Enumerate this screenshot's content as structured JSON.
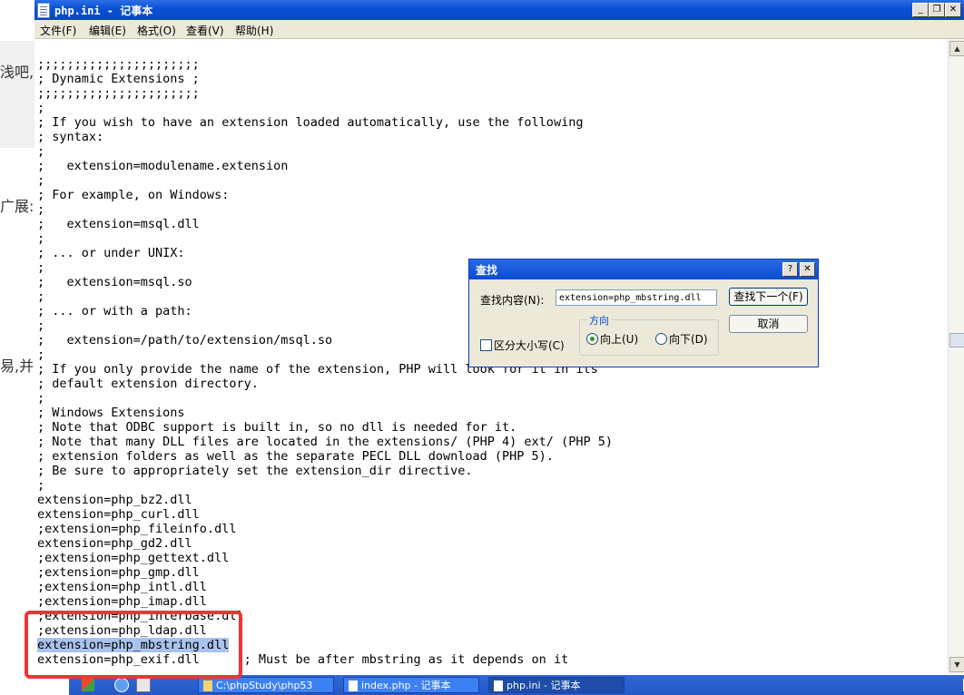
{
  "background_page": {
    "fragments": [
      "浅吧,山",
      "广展:",
      "易,并"
    ]
  },
  "window": {
    "title": "php.ini - 记事本",
    "controls": {
      "minimize": "_",
      "restore": "❐",
      "close": "✕"
    },
    "menu": [
      "文件(F)",
      "编辑(E)",
      "格式(O)",
      "查看(V)",
      "帮助(H)"
    ]
  },
  "editor": {
    "lines_before_selection": ";;;;;;;;;;;;;;;;;;;;;;\n; Dynamic Extensions ;\n;;;;;;;;;;;;;;;;;;;;;;\n;\n; If you wish to have an extension loaded automatically, use the following\n; syntax:\n;\n;   extension=modulename.extension\n;\n; For example, on Windows:\n;\n;   extension=msql.dll\n;\n; ... or under UNIX:\n;\n;   extension=msql.so\n;\n; ... or with a path:\n;\n;   extension=/path/to/extension/msql.so\n;\n; If you only provide the name of the extension, PHP will look for it in its\n; default extension directory.\n;\n; Windows Extensions\n; Note that ODBC support is built in, so no dll is needed for it.\n; Note that many DLL files are located in the extensions/ (PHP 4) ext/ (PHP 5)\n; extension folders as well as the separate PECL DLL download (PHP 5).\n; Be sure to appropriately set the extension_dir directive.\n;\nextension=php_bz2.dll\nextension=php_curl.dll\n;extension=php_fileinfo.dll\nextension=php_gd2.dll\n;extension=php_gettext.dll\n;extension=php_gmp.dll\n;extension=php_intl.dll\n;extension=php_imap.dll\n;extension=php_interbase.dll\n;extension=php_ldap.dll\n",
    "selected_line": "extension=php_mbstring.dll",
    "lines_after_selection": "\nextension=php_exif.dll      ; Must be after mbstring as it depends on it"
  },
  "find_dialog": {
    "title": "查找",
    "help": "?",
    "close": "✕",
    "find_label": "查找内容(N):",
    "find_value": "extension=php_mbstring.dll",
    "find_next": "查找下一个(F)",
    "cancel": "取消",
    "direction_label": "方向",
    "up": "向上(U)",
    "down": "向下(D)",
    "match_case": "区分大小写(C)"
  },
  "taskbar": {
    "tasks": [
      "C:\\phpStudy\\php53",
      "index.php - 记事本",
      "php.ini - 记事本"
    ]
  }
}
